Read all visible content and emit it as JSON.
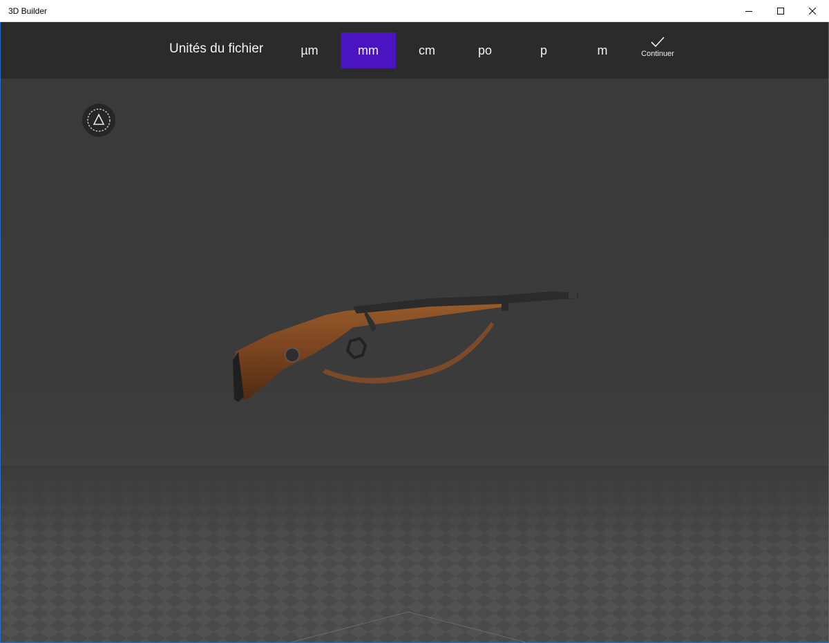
{
  "window": {
    "title": "3D Builder",
    "minimize_icon": "minimize-icon",
    "maximize_icon": "maximize-icon",
    "close_icon": "close-icon"
  },
  "units_bar": {
    "label": "Unités du fichier",
    "options": [
      {
        "label": "µm",
        "selected": false
      },
      {
        "label": "mm",
        "selected": true
      },
      {
        "label": "cm",
        "selected": false
      },
      {
        "label": "po",
        "selected": false
      },
      {
        "label": "p",
        "selected": false
      },
      {
        "label": "m",
        "selected": false
      }
    ],
    "selected_color": "#4a14c0",
    "continue": {
      "label": "Continuer",
      "icon": "checkmark-icon"
    }
  },
  "viewport": {
    "view_toggle_icon": "view-mode-triangle-icon",
    "model": "rifle-3d-model"
  }
}
